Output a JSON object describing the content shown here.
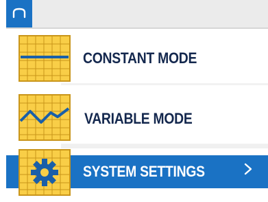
{
  "header": {
    "home_icon": "home-caret-icon"
  },
  "menu": {
    "items": [
      {
        "label": "CONSTANT MODE",
        "icon": "constant-line-grid-icon",
        "selected": false
      },
      {
        "label": "VARIABLE MODE",
        "icon": "variable-wave-grid-icon",
        "selected": false
      },
      {
        "label": "SYSTEM SETTINGS",
        "icon": "gear-grid-icon",
        "selected": true,
        "chevron": "chevron-right-icon"
      }
    ]
  },
  "colors": {
    "accent_blue": "#1a72c4",
    "tile_yellow": "#f9ce47",
    "tile_border": "#c9951a",
    "text_navy": "#14284e",
    "header_gray": "#ebebeb"
  }
}
